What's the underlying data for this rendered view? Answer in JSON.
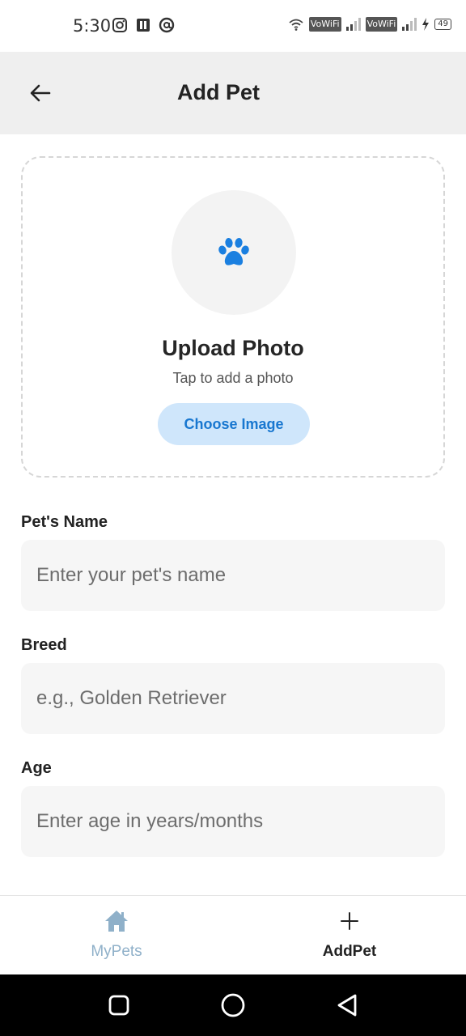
{
  "status_bar": {
    "time": "5:30",
    "vowifi_1": "VoWiFi",
    "vowifi_2": "VoWiFi",
    "battery": "49"
  },
  "header": {
    "title": "Add Pet",
    "back_icon": "arrow-left-icon"
  },
  "upload": {
    "icon": "paw-icon",
    "title": "Upload Photo",
    "subtitle": "Tap to add a photo",
    "button_label": "Choose Image"
  },
  "form": {
    "pet_name": {
      "label": "Pet's Name",
      "placeholder": "Enter your pet's name",
      "value": ""
    },
    "breed": {
      "label": "Breed",
      "placeholder": "e.g., Golden Retriever",
      "value": ""
    },
    "age": {
      "label": "Age",
      "placeholder": "Enter age in years/months",
      "value": ""
    }
  },
  "tabs": [
    {
      "label": "MyPets",
      "icon": "home-icon",
      "active": false
    },
    {
      "label": "AddPet",
      "icon": "plus-icon",
      "active": true
    }
  ],
  "colors": {
    "accent": "#1877d0",
    "accent_light": "#cfe6fb",
    "inactive_tab": "#8fb0c9",
    "header_bg": "#efefef"
  }
}
